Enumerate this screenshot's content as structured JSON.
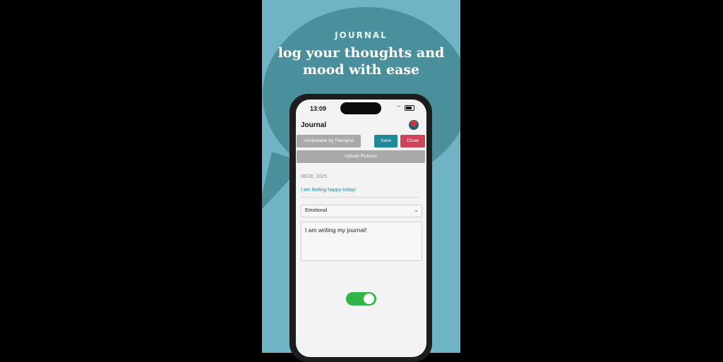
{
  "promo": {
    "eyebrow": "JOURNAL",
    "headline_line1": "log your thoughts and",
    "headline_line2": "mood with ease"
  },
  "status_bar": {
    "time": "13:09"
  },
  "nav": {
    "title": "Journal"
  },
  "actions": {
    "unviewable_label": "Unviewable by Therapist",
    "save_label": "Save",
    "close_label": "Close",
    "upload_label": "Upload Pictures"
  },
  "entry": {
    "date": "06/28, 2025",
    "mood_title": "I am feeling happy today!",
    "category": "Emotional",
    "body": "I am writing my journal!"
  },
  "toggle": {
    "state": "on"
  },
  "colors": {
    "accent_teal": "#1f8899",
    "close_red": "#d0445a",
    "toggle_green": "#31b549",
    "panel_bg": "#6fb4c4"
  }
}
